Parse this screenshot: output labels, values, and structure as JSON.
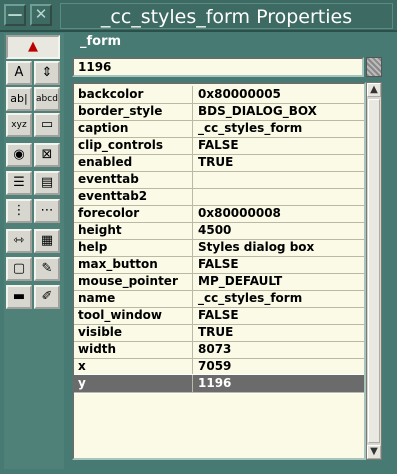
{
  "window": {
    "title": "_cc_styles_form Properties",
    "form_label": "_form",
    "current_value": "1196"
  },
  "palette": {
    "items": [
      {
        "name": "pointer-tool-icon",
        "glyph": "▲"
      },
      {
        "name": "text-tool-icon",
        "glyph": "A"
      },
      {
        "name": "spinner-tool-icon",
        "glyph": "⇕"
      },
      {
        "name": "entryfield-tool-icon",
        "glyph": "ab|"
      },
      {
        "name": "multiline-tool-icon",
        "glyph": "abcd"
      },
      {
        "name": "groupbox-tool-icon",
        "glyph": "xyz"
      },
      {
        "name": "pushbutton-tool-icon",
        "glyph": "▭"
      },
      {
        "name": "radiobutton-tool-icon",
        "glyph": "◉"
      },
      {
        "name": "checkbox-tool-icon",
        "glyph": "⊠"
      },
      {
        "name": "listbox-tool-icon",
        "glyph": "☰"
      },
      {
        "name": "combobox-tool-icon",
        "glyph": "▤"
      },
      {
        "name": "vscroll-tool-icon",
        "glyph": "⋮"
      },
      {
        "name": "hscroll-tool-icon",
        "glyph": "⋯"
      },
      {
        "name": "slider-tool-icon",
        "glyph": "⇿"
      },
      {
        "name": "browse-tool-icon",
        "glyph": "▦"
      },
      {
        "name": "folder-tool-icon",
        "glyph": "▢"
      },
      {
        "name": "image-tool-icon",
        "glyph": "✎"
      },
      {
        "name": "progress-tool-icon",
        "glyph": "▬"
      },
      {
        "name": "ole-tool-icon",
        "glyph": "✐"
      }
    ]
  },
  "properties": [
    {
      "key": "backcolor",
      "value": "0x80000005"
    },
    {
      "key": "border_style",
      "value": "BDS_DIALOG_BOX"
    },
    {
      "key": "caption",
      "value": "_cc_styles_form"
    },
    {
      "key": "clip_controls",
      "value": "FALSE"
    },
    {
      "key": "enabled",
      "value": "TRUE"
    },
    {
      "key": "eventtab",
      "value": ""
    },
    {
      "key": "eventtab2",
      "value": ""
    },
    {
      "key": "forecolor",
      "value": "0x80000008"
    },
    {
      "key": "height",
      "value": "4500"
    },
    {
      "key": "help",
      "value": "Styles dialog box"
    },
    {
      "key": "max_button",
      "value": "FALSE"
    },
    {
      "key": "mouse_pointer",
      "value": "MP_DEFAULT"
    },
    {
      "key": "name",
      "value": "_cc_styles_form"
    },
    {
      "key": "tool_window",
      "value": "FALSE"
    },
    {
      "key": "visible",
      "value": "TRUE"
    },
    {
      "key": "width",
      "value": "8073"
    },
    {
      "key": "x",
      "value": "7059"
    },
    {
      "key": "y",
      "value": "1196"
    }
  ],
  "selected_property": "y",
  "colors": {
    "background": "#477a72",
    "grid": "#fafae6",
    "selected_row": "#6b6b6b"
  }
}
